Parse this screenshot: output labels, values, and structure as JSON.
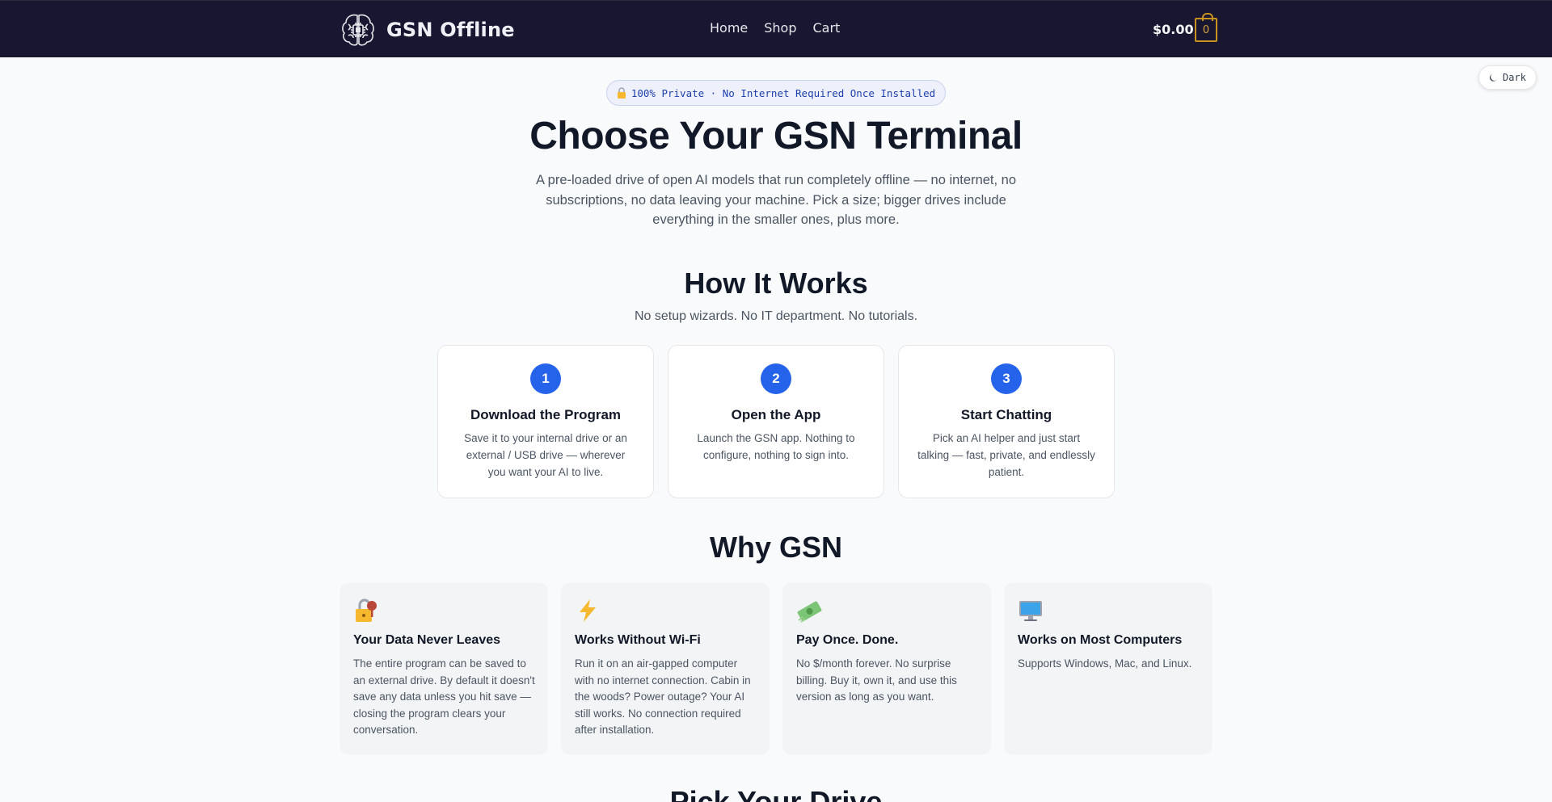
{
  "header": {
    "brand": "GSN Offline",
    "nav": [
      "Home",
      "Shop",
      "Cart"
    ],
    "cart_total": "$0.00",
    "cart_count": "0"
  },
  "theme_toggle": {
    "label": "Dark",
    "icon": "moon-icon"
  },
  "hero": {
    "badge": "100% Private · No Internet Required Once Installed",
    "badge_icon": "lock-icon",
    "title": "Choose Your GSN Terminal",
    "subtitle": "A pre-loaded drive of open AI models that run completely offline — no internet, no subscriptions, no data leaving your machine. Pick a size; bigger drives include everything in the smaller ones, plus more."
  },
  "how_it_works": {
    "title": "How It Works",
    "subtitle": "No setup wizards. No IT department. No tutorials.",
    "steps": [
      {
        "num": "1",
        "title": "Download the Program",
        "text": "Save it to your internal drive or an external / USB drive — wherever you want your AI to live."
      },
      {
        "num": "2",
        "title": "Open the App",
        "text": "Launch the GSN app. Nothing to configure, nothing to sign into."
      },
      {
        "num": "3",
        "title": "Start Chatting",
        "text": "Pick an AI helper and just start talking — fast, private, and endlessly patient."
      }
    ]
  },
  "why_gsn": {
    "title": "Why GSN",
    "cards": [
      {
        "icon": "lock-with-key-icon",
        "title": "Your Data Never Leaves",
        "text": "The entire program can be saved to an external drive. By default it doesn't save any data unless you hit save — closing the program clears your conversation."
      },
      {
        "icon": "lightning-icon",
        "title": "Works Without Wi-Fi",
        "text": "Run it on an air-gapped computer with no internet connection. Cabin in the woods? Power outage? Your AI still works. No connection required after installation."
      },
      {
        "icon": "money-icon",
        "title": "Pay Once. Done.",
        "text": "No $/month forever. No surprise billing. Buy it, own it, and use this version as long as you want."
      },
      {
        "icon": "computer-icon",
        "title": "Works on Most Computers",
        "text": "Supports Windows, Mac, and Linux."
      }
    ]
  },
  "pick_drive": {
    "title": "Pick Your Drive"
  },
  "colors": {
    "header_bg": "#181630",
    "accent": "#2563eb",
    "cart_gold": "#c8941f"
  }
}
